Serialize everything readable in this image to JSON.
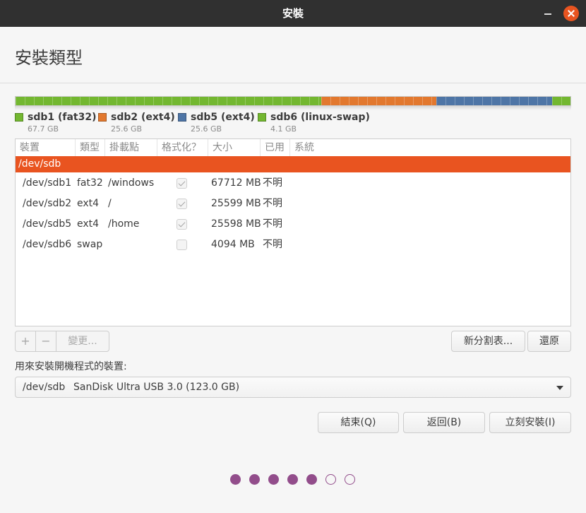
{
  "window": {
    "title": "安裝"
  },
  "header": {
    "title": "安裝類型"
  },
  "partition_bar": {
    "segments": [
      {
        "name": "sdb1 (fat32)",
        "size": "67.7 GB",
        "color": "#73b730",
        "fraction": 0.5516
      },
      {
        "name": "sdb2 (ext4)",
        "size": "25.6 GB",
        "color": "#e2782e",
        "fraction": 0.2086
      },
      {
        "name": "sdb5 (ext4)",
        "size": "25.6 GB",
        "color": "#4e75a6",
        "fraction": 0.2085
      },
      {
        "name": "sdb6 (linux-swap)",
        "size": "4.1 GB",
        "color": "#73b730",
        "fraction": 0.0333
      }
    ]
  },
  "table": {
    "columns": [
      "裝置",
      "類型",
      "掛載點",
      "格式化？",
      "大小",
      "已用",
      "系統"
    ],
    "selected_device": "/dev/sdb",
    "rows": [
      {
        "device": "/dev/sdb1",
        "type": "fat32",
        "mount": "/windows",
        "format": true,
        "size": "67712 MB",
        "used": "不明"
      },
      {
        "device": "/dev/sdb2",
        "type": "ext4",
        "mount": "/",
        "format": true,
        "size": "25599 MB",
        "used": "不明"
      },
      {
        "device": "/dev/sdb5",
        "type": "ext4",
        "mount": "/home",
        "format": true,
        "size": "25598 MB",
        "used": "不明"
      },
      {
        "device": "/dev/sdb6",
        "type": "swap",
        "mount": "",
        "format": false,
        "size": "4094 MB",
        "used": "不明"
      }
    ]
  },
  "toolbar": {
    "add": "+",
    "remove": "−",
    "change": "變更...",
    "new_table": "新分割表...",
    "revert": "還原"
  },
  "bootloader": {
    "label": "用來安裝開機程式的裝置:",
    "device": "/dev/sdb",
    "description": "SanDisk Ultra USB 3.0 (123.0 GB)"
  },
  "actions": {
    "quit": "結束(Q)",
    "back": "返回(B)",
    "install": "立刻安裝(I)"
  },
  "progress": {
    "total_steps": 7,
    "completed_steps": 5
  }
}
